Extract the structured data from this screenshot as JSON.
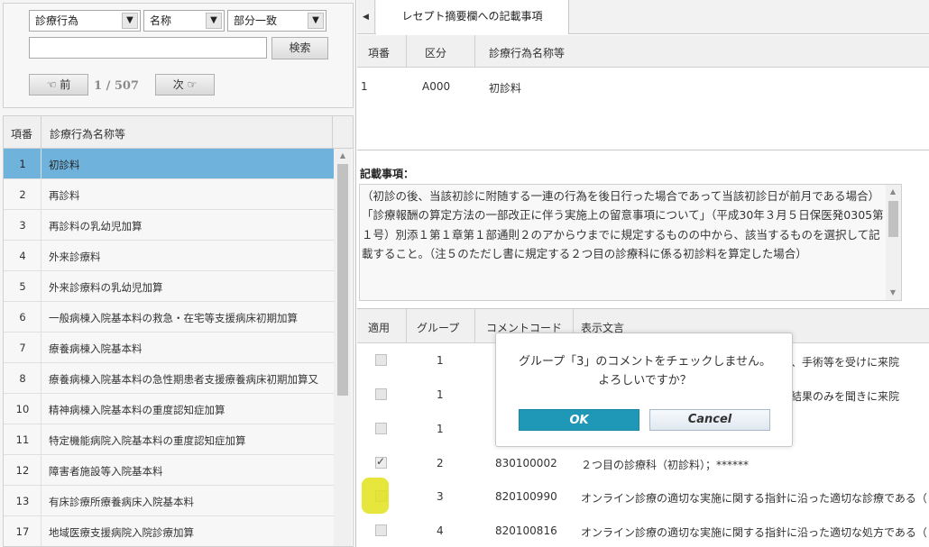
{
  "search": {
    "kind_select": "診療行為",
    "field_select": "名称",
    "match_select": "部分一致",
    "keyword": "",
    "search_label": "検索",
    "prev_label": "☜ 前",
    "next_label": "次 ☞",
    "page_indicator": "1 / 507"
  },
  "list": {
    "col_no": "項番",
    "col_name": "診療行為名称等",
    "rows": [
      {
        "no": "1",
        "name": "初診料"
      },
      {
        "no": "2",
        "name": "再診料"
      },
      {
        "no": "3",
        "name": "再診料の乳幼児加算"
      },
      {
        "no": "4",
        "name": "外来診療料"
      },
      {
        "no": "5",
        "name": "外来診療料の乳幼児加算"
      },
      {
        "no": "6",
        "name": "一般病棟入院基本料の救急・在宅等支援病床初期加算"
      },
      {
        "no": "7",
        "name": "療養病棟入院基本料"
      },
      {
        "no": "8",
        "name": "療養病棟入院基本料の急性期患者支援療養病床初期加算又"
      },
      {
        "no": "10",
        "name": "精神病棟入院基本料の重度認知症加算"
      },
      {
        "no": "11",
        "name": "特定機能病院入院基本料の重度認知症加算"
      },
      {
        "no": "12",
        "name": "障害者施設等入院基本料"
      },
      {
        "no": "13",
        "name": "有床診療所療養病床入院基本料"
      },
      {
        "no": "17",
        "name": "地域医療支援病院入院診療加算"
      }
    ]
  },
  "tabs": {
    "active_label": "レセプト摘要欄への記載事項"
  },
  "head_table": {
    "col_no": "項番",
    "col_category": "区分",
    "col_name": "診療行為名称等",
    "row": {
      "no": "1",
      "category": "A000",
      "name": "初診料"
    }
  },
  "notes": {
    "title": "記載事項：",
    "lines": [
      "（初診の後、当該初診に附随する一連の行為を後日行った場合であって当該初診日が前月である場合）",
      "「診療報酬の算定方法の一部改正に伴う実施上の留意事項について」（平成30年３月５日保医発0305第１号）別添１第１章第１部通則２のアからウまでに規定するものの中から、該当するものを選択して記載すること。（注５のただし書に規定する２つ目の診療科に係る初診料を算定した場合）"
    ]
  },
  "comments": {
    "col_apply": "適用",
    "col_group": "グループ",
    "col_code": "コメントコード",
    "col_text": "表示文言",
    "rows": [
      {
        "group": "1",
        "code": "",
        "text": "断、手術等を受けに来院",
        "checked": false
      },
      {
        "group": "1",
        "code": "",
        "text": "の結果のみを聞きに来院",
        "checked": false
      },
      {
        "group": "1",
        "code": "",
        "text": "",
        "checked": false
      },
      {
        "group": "2",
        "code": "830100002",
        "text": "２つ目の診療科（初診料）；******",
        "checked": true
      },
      {
        "group": "3",
        "code": "820100990",
        "text": "オンライン診療の適切な実施に関する指針に沿った適切な診療である（",
        "checked": false
      },
      {
        "group": "4",
        "code": "820100816",
        "text": "オンライン診療の適切な実施に関する指針に沿った適切な処方である（",
        "checked": false
      }
    ]
  },
  "dialog": {
    "line1": "グループ「3」のコメントをチェックしません。",
    "line2": "よろしいですか？",
    "ok_label": "OK",
    "cancel_label": "Cancel"
  },
  "colors": {
    "selected_row": "#6fb2dc",
    "ok_button": "#1f98b7",
    "highlight": "#e3e21a"
  }
}
